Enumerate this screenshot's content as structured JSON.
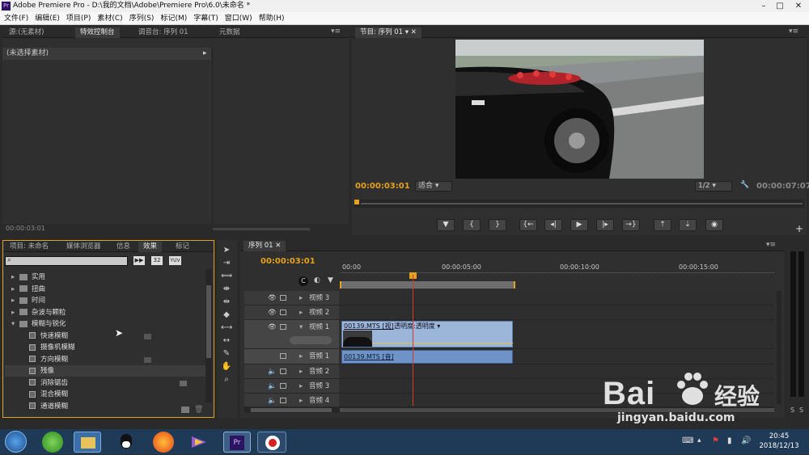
{
  "window": {
    "title": "Adobe Premiere Pro - D:\\我的文档\\Adobe\\Premiere Pro\\6.0\\未命名 *",
    "app_icon": "Pr"
  },
  "menu": [
    "文件(F)",
    "编辑(E)",
    "项目(P)",
    "素材(C)",
    "序列(S)",
    "标记(M)",
    "字幕(T)",
    "窗口(W)",
    "帮助(H)"
  ],
  "source_panel": {
    "tabs": [
      "源:(无素材)",
      "特效控制台",
      "调音台: 序列 01",
      "元数据"
    ],
    "no_clip": "(未选择素材)",
    "timecode": "00:00:03:01"
  },
  "program_panel": {
    "tab": "节目: 序列 01",
    "current_time": "00:00:03:01",
    "fit": "适合",
    "resolution": "1/2",
    "duration": "00:00:07:07"
  },
  "project_panel": {
    "tabs": [
      "项目: 未命名",
      "媒体浏览器",
      "信息",
      "效果",
      "标记"
    ],
    "badges": [
      "32",
      "YUV"
    ],
    "tree": [
      {
        "label": "实用",
        "type": "folder",
        "open": false,
        "indent": 0
      },
      {
        "label": "扭曲",
        "type": "folder",
        "open": false,
        "indent": 0
      },
      {
        "label": "时间",
        "type": "folder",
        "open": false,
        "indent": 0
      },
      {
        "label": "杂波与颗粒",
        "type": "folder",
        "open": false,
        "indent": 0
      },
      {
        "label": "模糊与锐化",
        "type": "folder",
        "open": true,
        "indent": 0
      },
      {
        "label": "快速模糊",
        "type": "effect",
        "indent": 1
      },
      {
        "label": "摄像机模糊",
        "type": "effect",
        "indent": 1
      },
      {
        "label": "方向模糊",
        "type": "effect",
        "indent": 1
      },
      {
        "label": "残像",
        "type": "effect",
        "indent": 1,
        "selected": true
      },
      {
        "label": "消除锯齿",
        "type": "effect",
        "indent": 1
      },
      {
        "label": "混合模糊",
        "type": "effect",
        "indent": 1
      },
      {
        "label": "通道模糊",
        "type": "effect",
        "indent": 1
      }
    ]
  },
  "timeline": {
    "tab": "序列 01",
    "timecode": "00:00:03:01",
    "ruler": [
      "00:00",
      "00:00:05:00",
      "00:00:10:00",
      "00:00:15:00"
    ],
    "tracks": [
      {
        "name": "视频 3",
        "kind": "video"
      },
      {
        "name": "视频 2",
        "kind": "video"
      },
      {
        "name": "视频 1",
        "kind": "video",
        "expanded": true
      },
      {
        "name": "音频 1",
        "kind": "audio"
      },
      {
        "name": "音频 2",
        "kind": "audio"
      },
      {
        "name": "音频 3",
        "kind": "audio"
      },
      {
        "name": "音频 4",
        "kind": "audio"
      }
    ],
    "video_clip": {
      "label": "00139.MTS [视]",
      "effect": "透明度:透明度"
    },
    "audio_clip": {
      "label": "00139.MTS [音]"
    }
  },
  "watermark": {
    "brand": "Bai",
    "brand2": "经验",
    "url": "jingyan.baidu.com"
  },
  "taskbar": {
    "time": "20:45",
    "date": "2018/12/13"
  },
  "colors": {
    "accent": "#e6a11d",
    "clip_video": "#9cb6d9",
    "clip_audio": "#6e93c7",
    "playhead": "#d23a2a"
  }
}
